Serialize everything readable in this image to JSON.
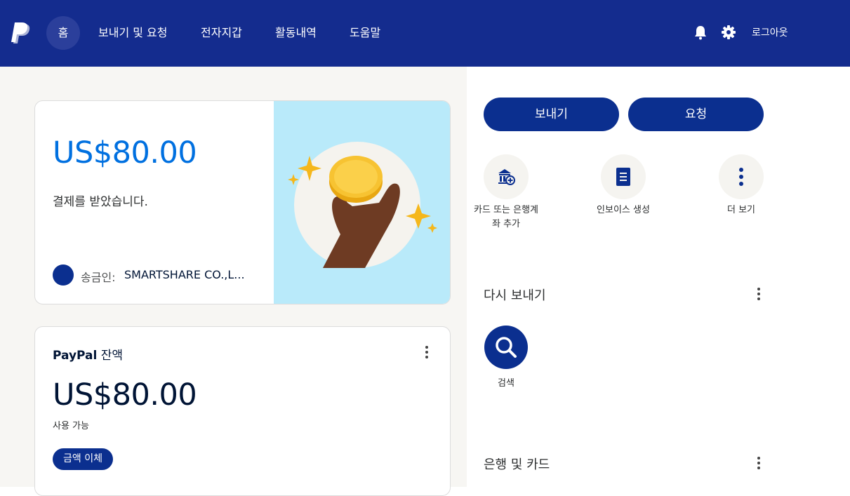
{
  "nav": {
    "home": "홈",
    "send_request": "보내기 및 요청",
    "wallet": "전자지갑",
    "activity": "활동내역",
    "help": "도움말",
    "logout": "로그아웃",
    "icons": [
      "paypal-logo",
      "bell-icon",
      "gear-icon"
    ]
  },
  "payment_card": {
    "amount": "US$80.00",
    "message": "결제를 받았습니다.",
    "sender_label": "송금인:",
    "sender_name": "SMARTSHARE CO.,L..."
  },
  "balance_card": {
    "brand": "PayPal",
    "title_suffix": "잔액",
    "amount": "US$80.00",
    "available": "사용 가능",
    "transfer_button": "금액 이체"
  },
  "actions": {
    "send": "보내기",
    "request": "요청"
  },
  "quick_actions": [
    {
      "label": "카드 또는 은행계좌 추가",
      "icon": "bank-add-icon"
    },
    {
      "label": "인보이스 생성",
      "icon": "invoice-icon"
    },
    {
      "label": "더 보기",
      "icon": "more-vertical-icon"
    }
  ],
  "send_again": {
    "title": "다시 보내기",
    "search_label": "검색"
  },
  "banks_cards": {
    "title": "은행 및 카드"
  },
  "colors": {
    "topbar": "#142c8e",
    "primary_button": "#0b2f8f",
    "amount_blue": "#0070e0",
    "illustration_bg": "#b9eafa"
  }
}
